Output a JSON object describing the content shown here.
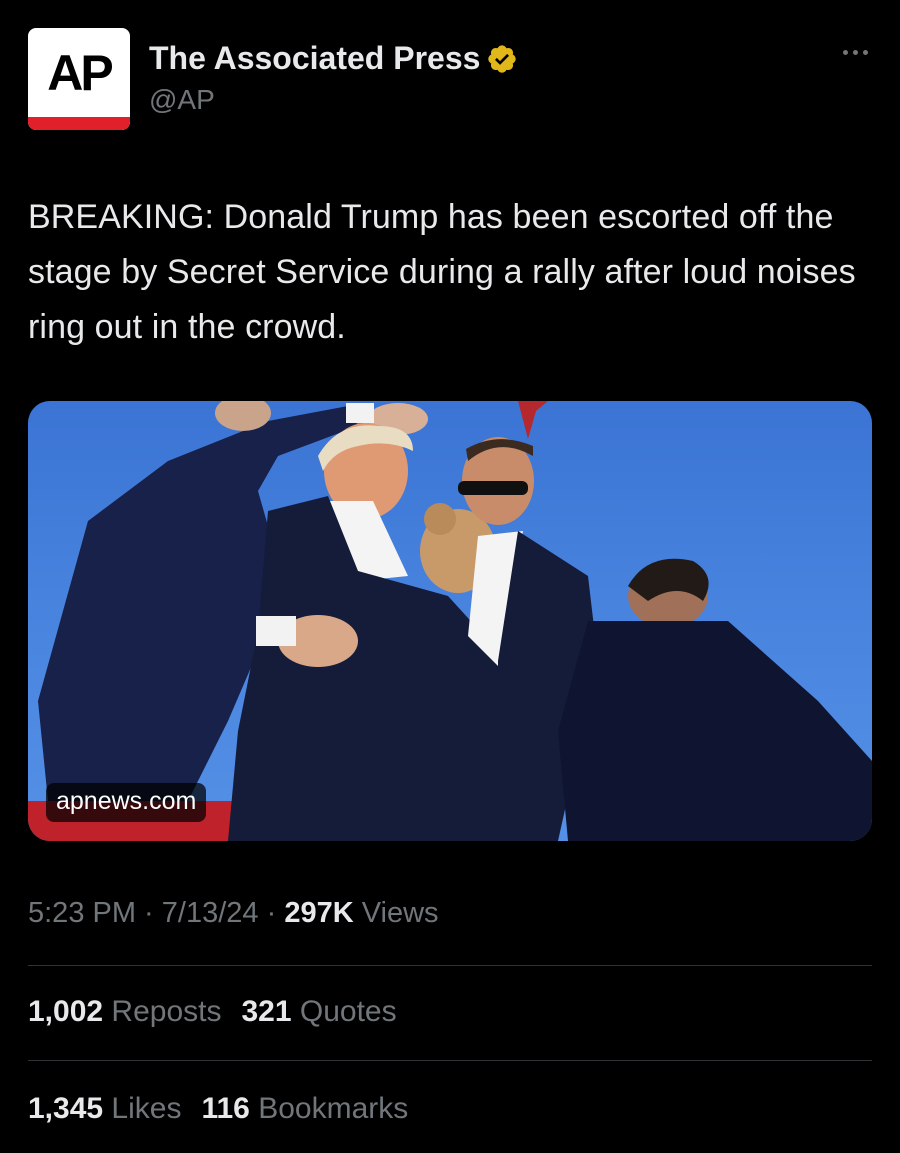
{
  "author": {
    "avatar_text": "AP",
    "display_name": "The Associated Press",
    "handle": "@AP",
    "verified_badge_color": "#e2b719"
  },
  "tweet": {
    "text": "BREAKING: Donald Trump has been escorted off the stage by Secret Service during a rally after loud noises ring out in the crowd."
  },
  "media": {
    "link_label": "apnews.com",
    "sky_color": "#4a86e0",
    "suit_color": "#141c3a"
  },
  "meta": {
    "time": "5:23 PM",
    "separator": " · ",
    "date": "7/13/24",
    "views_count": "297K",
    "views_label": " Views"
  },
  "stats": {
    "reposts_count": "1,002",
    "reposts_label": "Reposts",
    "quotes_count": "321",
    "quotes_label": "Quotes",
    "likes_count": "1,345",
    "likes_label": "Likes",
    "bookmarks_count": "116",
    "bookmarks_label": "Bookmarks"
  },
  "colors": {
    "background": "#000000",
    "primary_text": "#e7e9ea",
    "secondary_text": "#71767b",
    "divider": "#2f3336",
    "brand_red": "#e0202a"
  }
}
